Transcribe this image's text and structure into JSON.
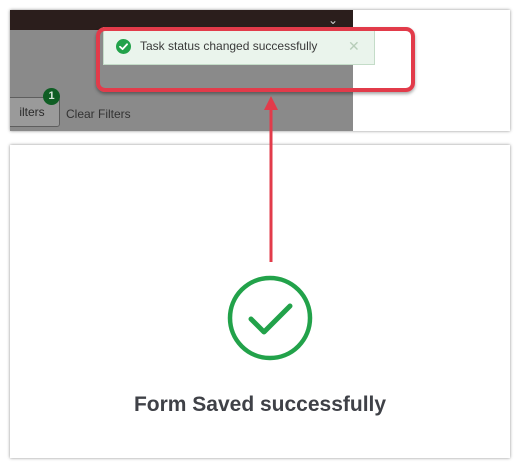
{
  "toast": {
    "message": "Task status changed successfully",
    "close_glyph": "✕",
    "check_icon": "check-circle-icon"
  },
  "filters": {
    "button_label": "ilters",
    "badge_count": "1",
    "clear_label": "Clear Filters"
  },
  "header": {
    "close_glyph": "⌄"
  },
  "saved": {
    "message": "Form Saved successfully",
    "icon": "check-circle-outline-icon"
  },
  "colors": {
    "highlight": "#e23b4a",
    "success_green": "#22a24a",
    "toast_bg": "#eaf4ec",
    "overlay": "#8a8a8a"
  }
}
